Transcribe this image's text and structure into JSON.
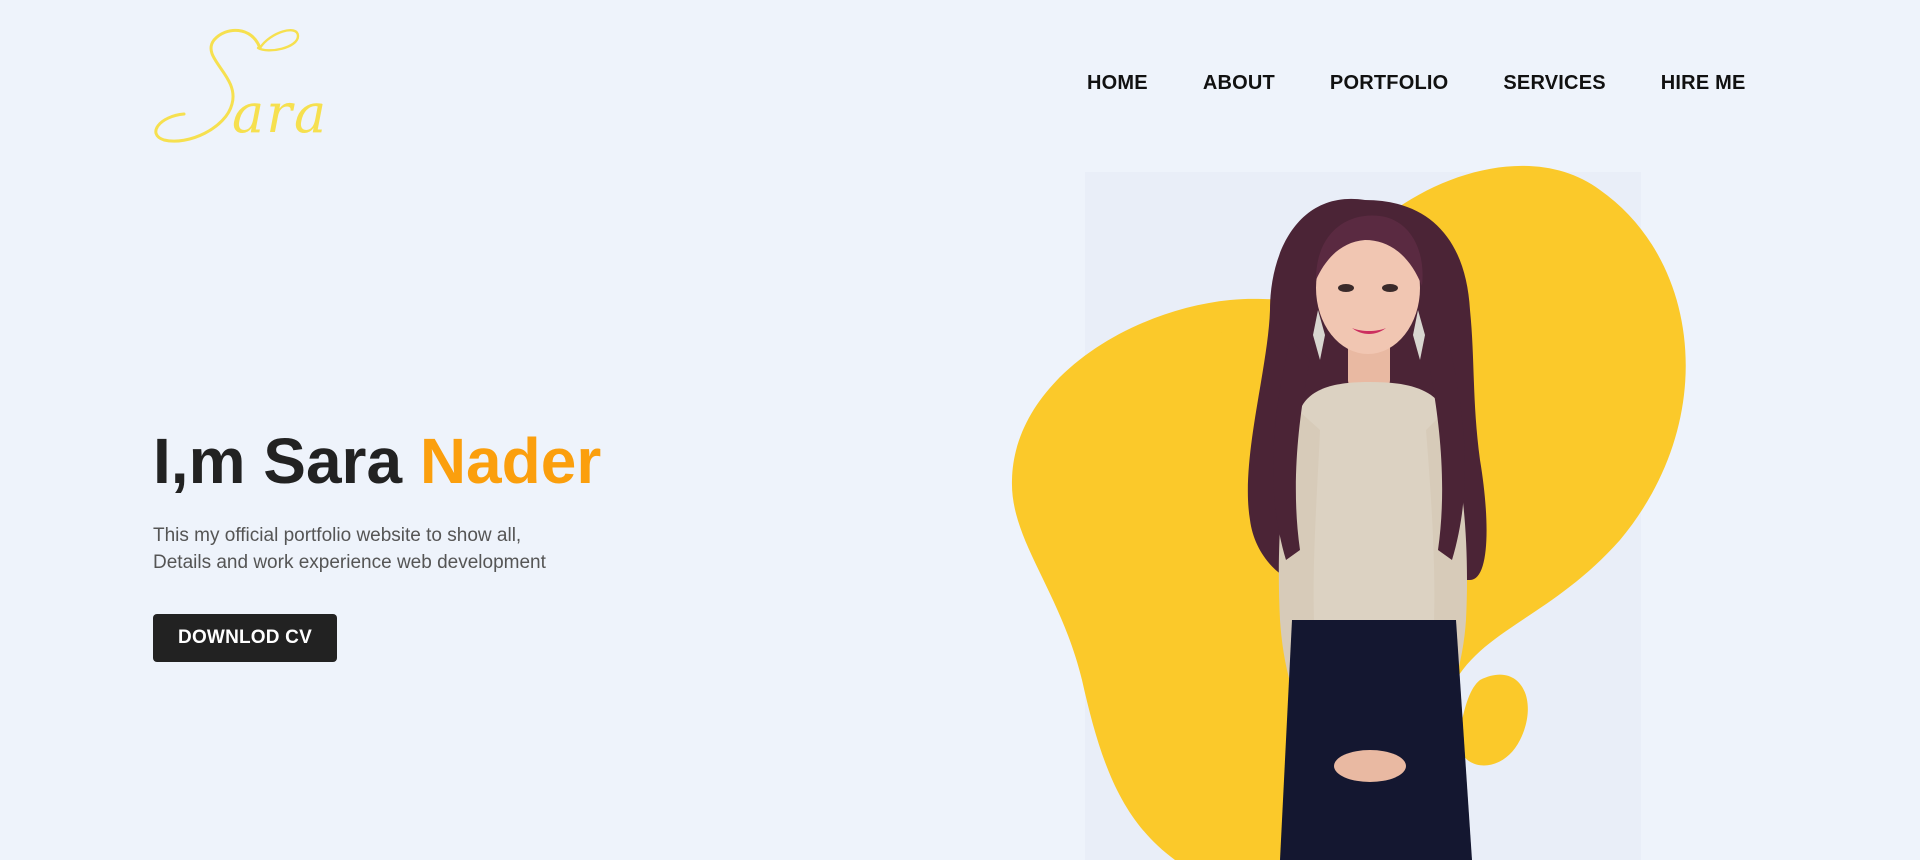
{
  "header": {
    "logo_text": "Sara",
    "nav": [
      {
        "label": "HOME"
      },
      {
        "label": "ABOUT"
      },
      {
        "label": "PORTFOLIO"
      },
      {
        "label": "SERVICES"
      },
      {
        "label": "HIRE ME"
      }
    ]
  },
  "hero": {
    "title_main": "I,m Sara ",
    "title_accent": "Nader",
    "subtitle_line1": "This my official portfolio website to show all,",
    "subtitle_line2": "Details and work experience web development",
    "cta_label": "DOWNLOD CV"
  },
  "colors": {
    "background": "#eef3fb",
    "accent": "#fb9f0d",
    "blob": "#fbc92a",
    "logo": "#f6e04f",
    "dark": "#222222"
  },
  "icons": {
    "portrait": "person-photo"
  }
}
